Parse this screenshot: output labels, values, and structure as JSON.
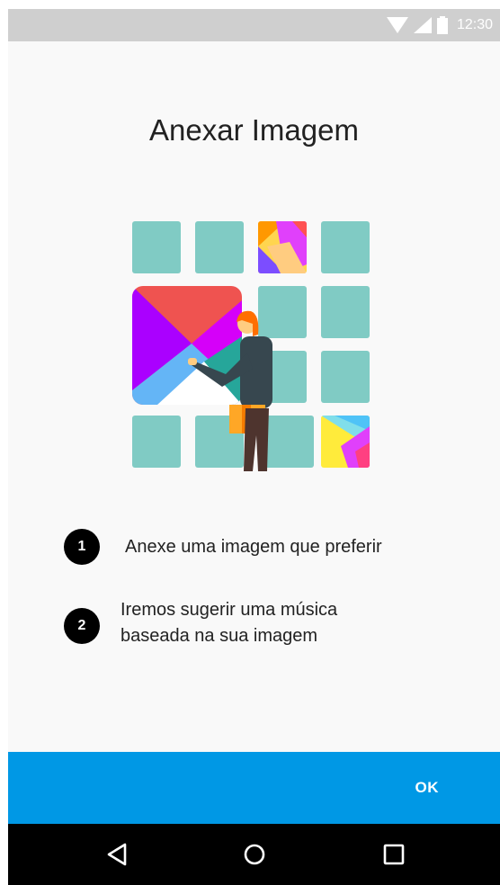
{
  "status_bar": {
    "time": "12:30",
    "icons": [
      "wifi-icon",
      "cell-signal-icon",
      "battery-icon"
    ]
  },
  "title": "Anexar Imagem",
  "steps": [
    {
      "number": "1",
      "text": "Anexe uma imagem que preferir"
    },
    {
      "number": "2",
      "text_line1": "Iremos sugerir uma música",
      "text_line2": "baseada na sua imagem"
    }
  ],
  "ok_button": {
    "label": "OK"
  },
  "nav_bar": {
    "icons": [
      "back-icon",
      "home-icon",
      "recents-icon"
    ]
  },
  "colors": {
    "status_bar": "#cfcfcf",
    "background": "#f9f9f9",
    "tile": "#80cbc4",
    "action_bar": "#0098e5",
    "nav_bar": "#000000"
  }
}
